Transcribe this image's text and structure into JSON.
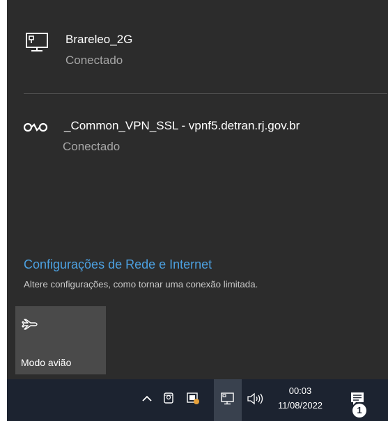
{
  "networks": [
    {
      "name": "Brareleo_2G",
      "status": "Conectado",
      "icon": "ethernet-monitor-icon"
    },
    {
      "name": "_Common_VPN_SSL - vpnf5.detran.rj.gov.br",
      "status": "Conectado",
      "icon": "vpn-icon"
    }
  ],
  "settings": {
    "link_label": "Configurações de Rede e Internet",
    "description": "Altere configurações, como tornar uma conexão limitada."
  },
  "quick_action": {
    "label": "Modo avião",
    "icon": "airplane-icon"
  },
  "taskbar": {
    "time": "00:03",
    "date": "11/08/2022",
    "notification_count": "1",
    "tray_icons": [
      "chevron-up-icon",
      "camera-icon",
      "app-tray-icon",
      "network-icon",
      "volume-icon"
    ]
  },
  "colors": {
    "flyout_bg": "#2c2c2c",
    "accent_link": "#4ca0e0",
    "taskbar_bg": "#1c2330",
    "tile_bg": "#4a4a4a",
    "warning_dot": "#e7a13a"
  }
}
